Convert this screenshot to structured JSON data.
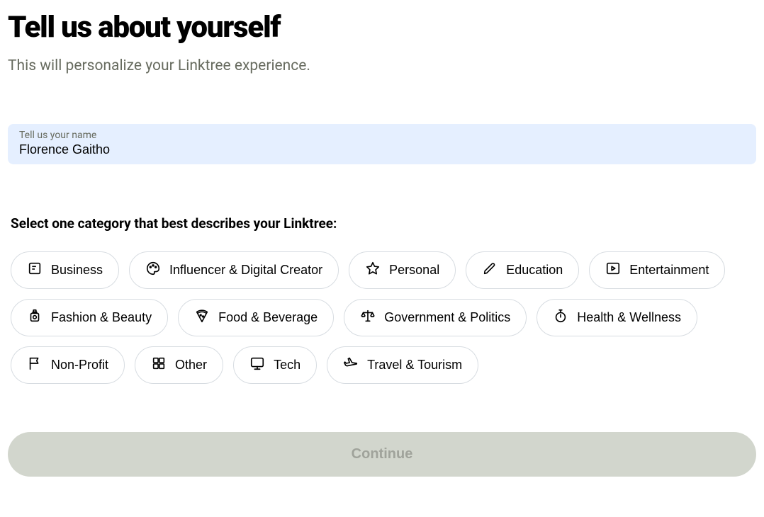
{
  "heading": "Tell us about yourself",
  "subheading": "This will personalize your Linktree experience.",
  "name_field": {
    "label": "Tell us your name",
    "value": "Florence Gaitho"
  },
  "category_heading": "Select one category that best describes your Linktree:",
  "categories": [
    {
      "label": "Business",
      "icon": "document-icon"
    },
    {
      "label": "Influencer & Digital Creator",
      "icon": "palette-icon"
    },
    {
      "label": "Personal",
      "icon": "star-icon"
    },
    {
      "label": "Education",
      "icon": "pencil-icon"
    },
    {
      "label": "Entertainment",
      "icon": "play-square-icon"
    },
    {
      "label": "Fashion & Beauty",
      "icon": "perfume-icon"
    },
    {
      "label": "Food & Beverage",
      "icon": "pizza-icon"
    },
    {
      "label": "Government & Politics",
      "icon": "scales-icon"
    },
    {
      "label": "Health & Wellness",
      "icon": "stopwatch-icon"
    },
    {
      "label": "Non-Profit",
      "icon": "flag-icon"
    },
    {
      "label": "Other",
      "icon": "grid-icon"
    },
    {
      "label": "Tech",
      "icon": "monitor-icon"
    },
    {
      "label": "Travel & Tourism",
      "icon": "plane-icon"
    }
  ],
  "continue_label": "Continue"
}
